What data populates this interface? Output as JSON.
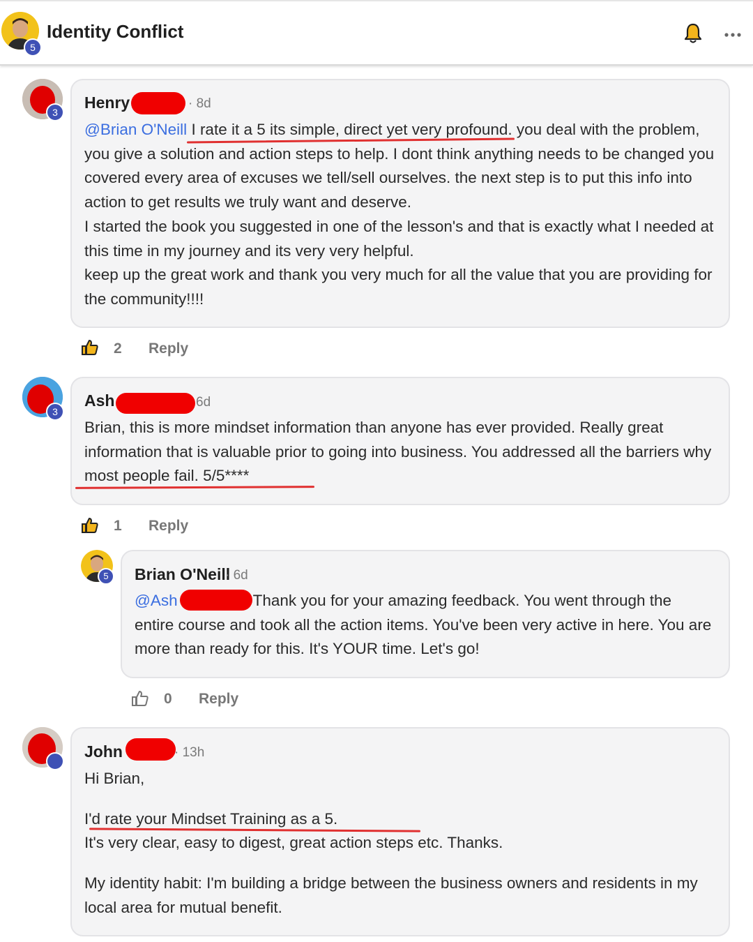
{
  "header": {
    "title": "Identity Conflict",
    "level": "5",
    "bell_icon": "bell-icon",
    "menu_icon": "more-horizontal-icon"
  },
  "comments": [
    {
      "name": "Henry",
      "time": "· 8d",
      "level": "3",
      "mention": "@Brian O'Neill",
      "text_first": " I rate it a 5 its simple, direct yet very profound. you deal with the problem, you give a solution and action steps to help. I dont think anything needs to be changed you covered every area of excuses we tell/sell ourselves. the next step is to put this info into action to get results we truly want and deserve.",
      "text_second": "I started the book you suggested in one of the lesson's and that is exactly what I needed at this time in my journey and its very very helpful.",
      "text_third": "keep up the great work and thank you very much for all the value that you are providing for the community!!!!",
      "likes": "2",
      "reply": "Reply"
    },
    {
      "name": "Ash",
      "time": "6d",
      "level": "3",
      "text": "Brian, this is more mindset information than anyone has ever provided. Really great information that is valuable prior to going into business. You addressed all the barriers why most people fail. 5/5****",
      "likes": "1",
      "reply": "Reply"
    },
    {
      "name": "Brian O'Neill",
      "time": "· 6d",
      "level": "5",
      "mention": "@Ash",
      "text": "Thank you for your amazing feedback. You went through the entire course and took all the action items. You've been very active in here. You are more than ready for this. It's YOUR time. Let's go!",
      "likes": "0",
      "reply": "Reply"
    },
    {
      "name": "John",
      "time": "· 13h",
      "greeting": "Hi Brian,",
      "line1": "I'd rate your Mindset Training as a 5.",
      "line2": "It's very clear, easy to digest, great action steps etc. Thanks.",
      "line3": "My identity habit: I'm building a bridge between the business owners and residents in my local area for mutual benefit."
    }
  ]
}
